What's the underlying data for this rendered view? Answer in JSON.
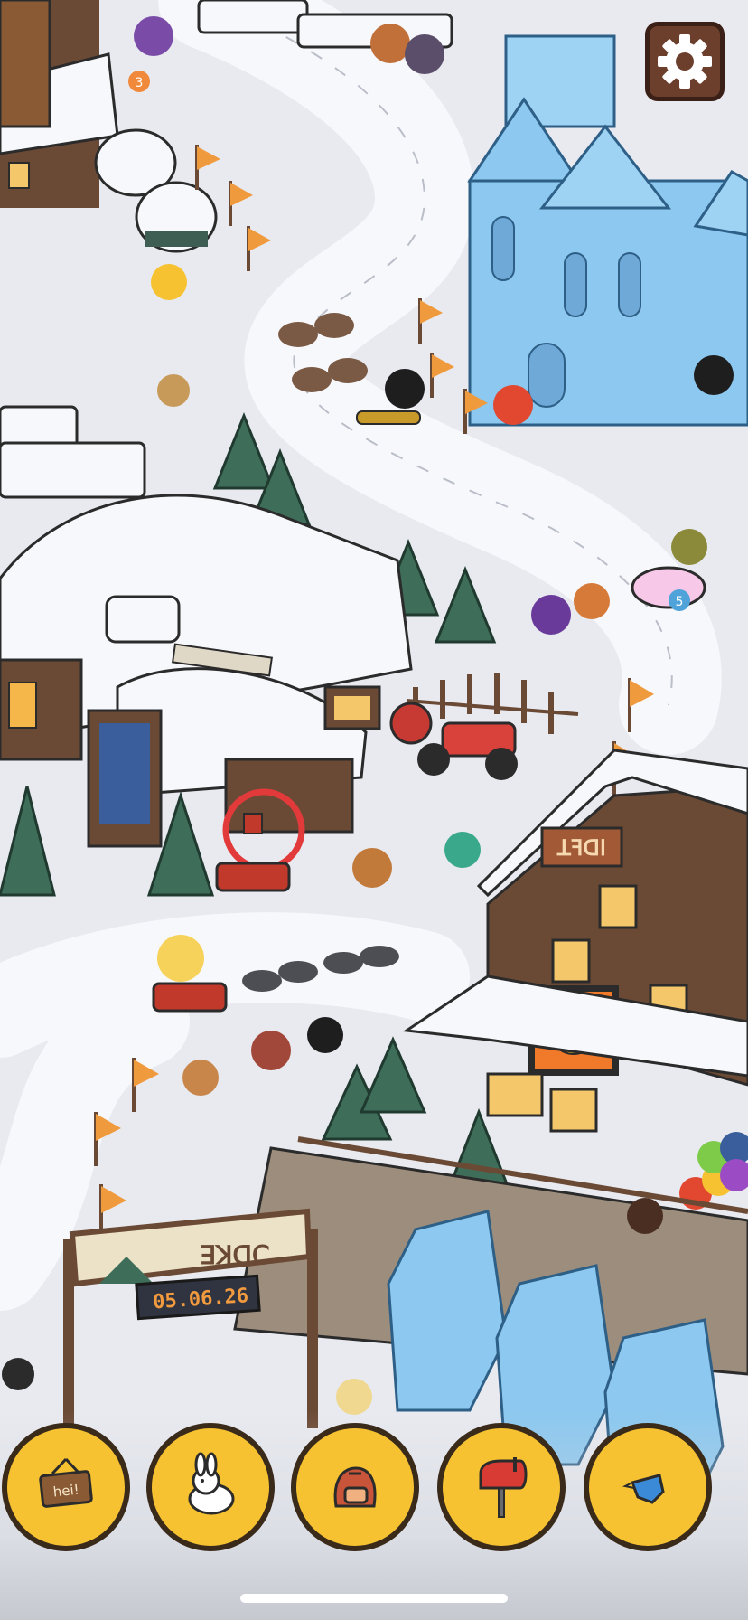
{
  "scene": {
    "shop_sign_text": "ꓕꟻꓷꓲ",
    "gate_sign_text": "ꓱꓘꓷꓚ",
    "timer_display": "05.06.26",
    "ring_number_1": "3",
    "ring_number_2": "5",
    "hidden_object_marker_color": "#e23a3a"
  },
  "settings": {
    "icon": "gear-icon"
  },
  "tray": {
    "items": [
      {
        "icon": "hanging-sign-icon",
        "label": "hei!"
      },
      {
        "icon": "snow-bunny-icon"
      },
      {
        "icon": "backpack-icon"
      },
      {
        "icon": "mailbox-icon"
      },
      {
        "icon": "blue-bird-icon"
      }
    ]
  },
  "colors": {
    "snow": "#f7f8fb",
    "ice": "#8cc8ef",
    "wood": "#6b4a35",
    "tray_yellow": "#f6c231",
    "flag_orange": "#f09a3e"
  }
}
